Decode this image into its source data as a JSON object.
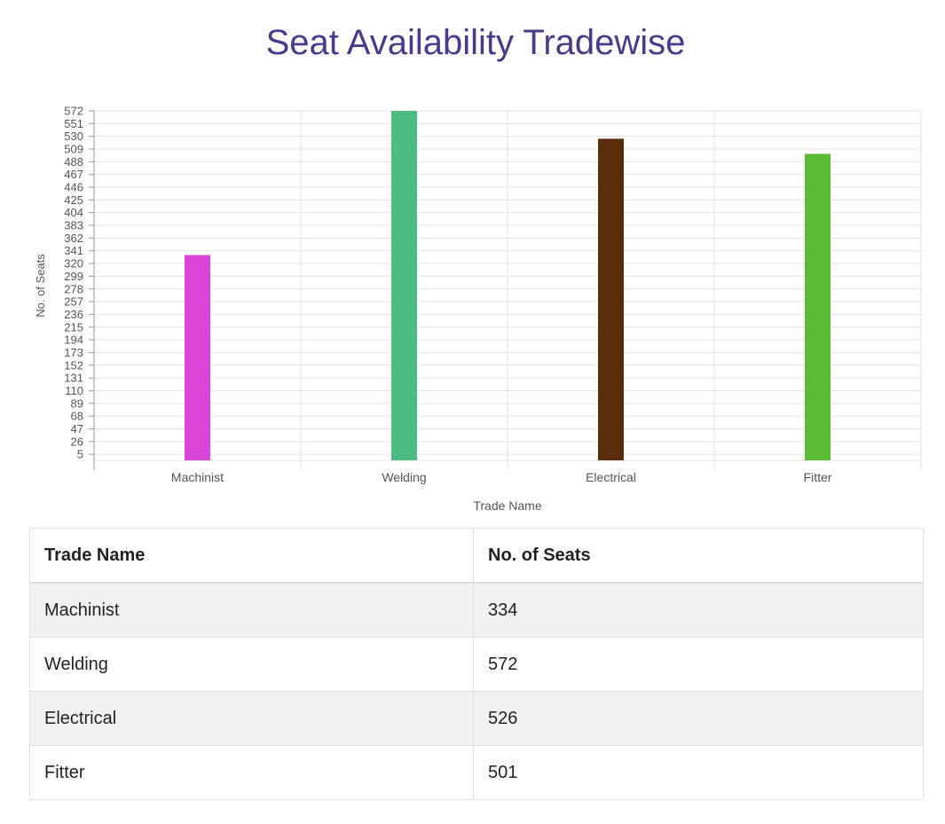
{
  "title": "Seat Availability Tradewise",
  "colors": {
    "title": "#4b3a8c",
    "grid": "#e3e3e3",
    "axis": "#9a9a9a",
    "tick_text": "#555555",
    "bars": [
      "#d945d6",
      "#4cbb7f",
      "#5a2d0c",
      "#5bbb35"
    ]
  },
  "chart_data": {
    "type": "bar",
    "categories": [
      "Machinist",
      "Welding",
      "Electrical",
      "Fitter"
    ],
    "values": [
      334,
      572,
      526,
      501
    ],
    "xlabel": "Trade Name",
    "ylabel": "No. of Seats",
    "yticks": [
      5,
      26,
      47,
      68,
      89,
      110,
      131,
      152,
      173,
      194,
      215,
      236,
      257,
      278,
      299,
      320,
      341,
      362,
      383,
      404,
      425,
      446,
      467,
      488,
      509,
      530,
      551,
      572
    ],
    "ylim": [
      -5,
      572
    ],
    "grid": true,
    "legend": "none"
  },
  "table": {
    "headers": [
      "Trade Name",
      "No. of Seats"
    ],
    "rows": [
      [
        "Machinist",
        "334"
      ],
      [
        "Welding",
        "572"
      ],
      [
        "Electrical",
        "526"
      ],
      [
        "Fitter",
        "501"
      ]
    ]
  }
}
